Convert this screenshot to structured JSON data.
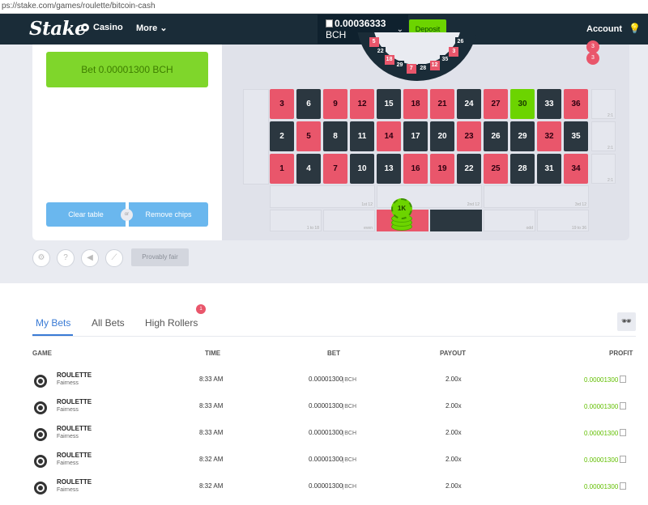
{
  "browser": {
    "url": "ps://stake.com/games/roulette/bitcoin-cash"
  },
  "nav": {
    "logo": "Stake",
    "casino": "Casino",
    "more": "More",
    "balance": "0.00036333",
    "currency": "BCH",
    "deposit": "Deposit",
    "account": "Account"
  },
  "panel": {
    "bet_label": "Bet 0.00001300 BCH",
    "clear_label": "Clear table",
    "or_label": "or",
    "remove_label": "Remove chips",
    "fair_label": "Provably fair"
  },
  "history": [
    "3",
    "3"
  ],
  "wheel_numbers": [
    "5",
    "22",
    "18",
    "29",
    "7",
    "28",
    "12",
    "35",
    "3",
    "26"
  ],
  "board": {
    "rows": [
      [
        "3",
        "6",
        "9",
        "12",
        "15",
        "18",
        "21",
        "24",
        "27",
        "30",
        "33",
        "36"
      ],
      [
        "2",
        "5",
        "8",
        "11",
        "14",
        "17",
        "20",
        "23",
        "26",
        "29",
        "32",
        "35"
      ],
      [
        "1",
        "4",
        "7",
        "10",
        "13",
        "16",
        "19",
        "22",
        "25",
        "28",
        "31",
        "34"
      ]
    ],
    "colors": [
      [
        "red",
        "black",
        "red",
        "red",
        "black",
        "red",
        "red",
        "black",
        "red",
        "green",
        "black",
        "red"
      ],
      [
        "black",
        "red",
        "black",
        "black",
        "red",
        "black",
        "black",
        "red",
        "black",
        "black",
        "red",
        "black"
      ],
      [
        "red",
        "black",
        "red",
        "black",
        "black",
        "red",
        "red",
        "black",
        "red",
        "black",
        "black",
        "red"
      ]
    ],
    "row_labels": [
      "2:1",
      "2:1",
      "2:1"
    ],
    "dozens": [
      "1st 12",
      "2nd 12",
      "3rd 12"
    ],
    "outside": [
      "1 to 18",
      "even",
      "",
      "",
      "odd",
      "19 to 36"
    ],
    "chip_label": "1K"
  },
  "tabs": [
    {
      "label": "My Bets"
    },
    {
      "label": "All Bets"
    },
    {
      "label": "High Rollers"
    }
  ],
  "high_rollers_badge": "1",
  "table": {
    "headers": {
      "game": "GAME",
      "time": "TIME",
      "bet": "BET",
      "payout": "PAYOUT",
      "profit": "PROFIT"
    },
    "rows": [
      {
        "game": "ROULETTE",
        "sub": "Fairness",
        "time": "8:33 AM",
        "bet": "0.00001300",
        "ccy": "BCH",
        "payout": "2.00x",
        "profit": "0.00001300"
      },
      {
        "game": "ROULETTE",
        "sub": "Fairness",
        "time": "8:33 AM",
        "bet": "0.00001300",
        "ccy": "BCH",
        "payout": "2.00x",
        "profit": "0.00001300"
      },
      {
        "game": "ROULETTE",
        "sub": "Fairness",
        "time": "8:33 AM",
        "bet": "0.00001300",
        "ccy": "BCH",
        "payout": "2.00x",
        "profit": "0.00001300"
      },
      {
        "game": "ROULETTE",
        "sub": "Fairness",
        "time": "8:32 AM",
        "bet": "0.00001300",
        "ccy": "BCH",
        "payout": "2.00x",
        "profit": "0.00001300"
      },
      {
        "game": "ROULETTE",
        "sub": "Fairness",
        "time": "8:32 AM",
        "bet": "0.00001300",
        "ccy": "BCH",
        "payout": "2.00x",
        "profit": "0.00001300"
      }
    ]
  },
  "colors": {
    "accent_green": "#6cd400",
    "nav_bg": "#1a2c38",
    "red": "#e9566b",
    "black": "#2b3740",
    "blue": "#6ab7ee"
  }
}
